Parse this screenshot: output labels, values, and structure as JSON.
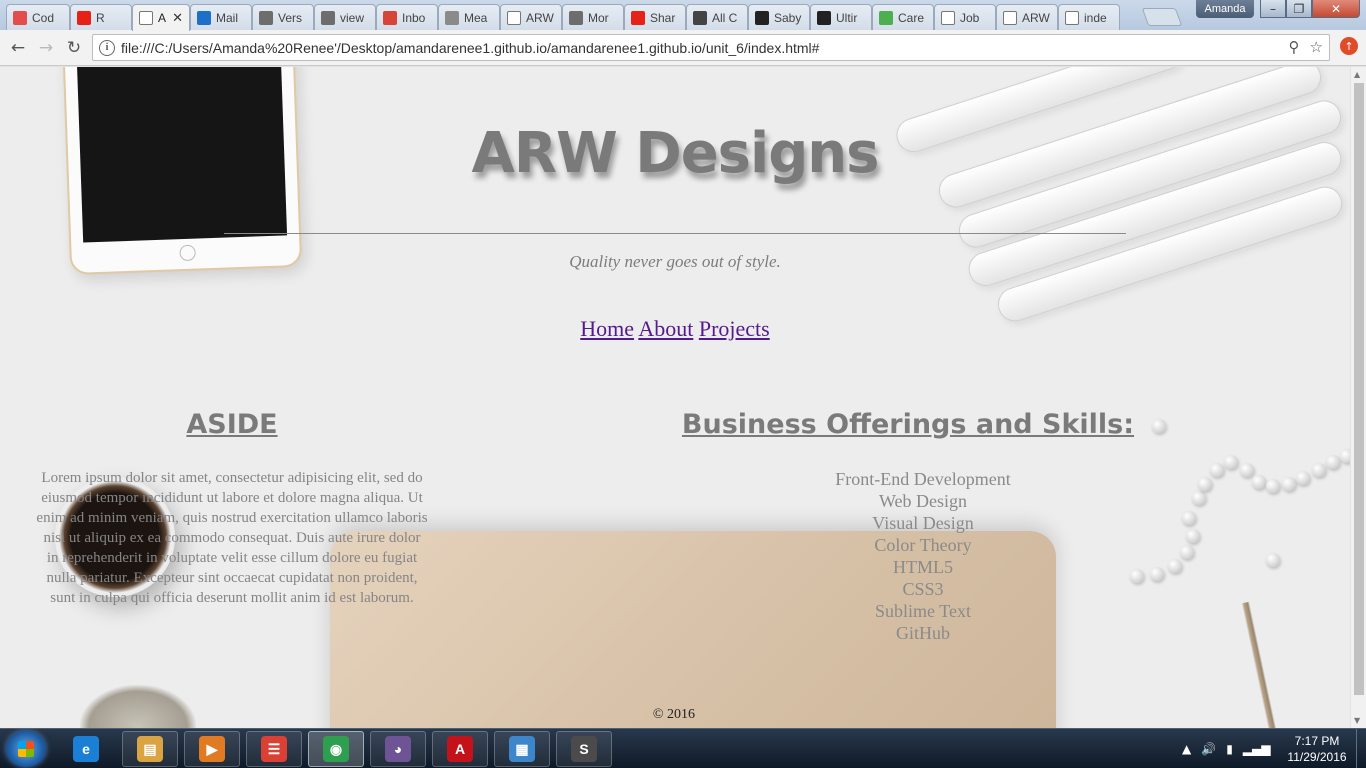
{
  "browser": {
    "tabs": [
      {
        "title": "Cod",
        "icon": "codecademy-icon",
        "color": "#e44d4d"
      },
      {
        "title": "R",
        "icon": "youtube-icon",
        "color": "#e62117"
      },
      {
        "title": "A",
        "icon": "page-icon",
        "color": "#ffffff",
        "active": true
      },
      {
        "title": "Mail",
        "icon": "outlook-icon",
        "color": "#1e6fc7"
      },
      {
        "title": "Vers",
        "icon": "b-icon",
        "color": "#6d6d6d"
      },
      {
        "title": "view",
        "icon": "b-icon",
        "color": "#6d6d6d"
      },
      {
        "title": "Inbo",
        "icon": "gmail-icon",
        "color": "#d64537"
      },
      {
        "title": "Mea",
        "icon": "eat-icon",
        "color": "#8a8a8a"
      },
      {
        "title": "ARW",
        "icon": "page-icon",
        "color": "#ffffff"
      },
      {
        "title": "Mor",
        "icon": "b-icon",
        "color": "#6d6d6d"
      },
      {
        "title": "Shar",
        "icon": "youtube-icon",
        "color": "#e62117"
      },
      {
        "title": "All C",
        "icon": "we-icon",
        "color": "#444444"
      },
      {
        "title": "Saby",
        "icon": "pb-icon",
        "color": "#222222"
      },
      {
        "title": "Ultir",
        "icon": "pb-icon",
        "color": "#222222"
      },
      {
        "title": "Care",
        "icon": "leaf-icon",
        "color": "#4caf50"
      },
      {
        "title": "Job",
        "icon": "page-icon",
        "color": "#ffffff"
      },
      {
        "title": "ARW",
        "icon": "page-icon",
        "color": "#ffffff"
      },
      {
        "title": "inde",
        "icon": "page-icon",
        "color": "#ffffff"
      }
    ],
    "user": "Amanda",
    "url": "file:///C:/Users/Amanda%20Renee'/Desktop/amandarenee1.github.io/amandarenee1.github.io/unit_6/index.html#",
    "info_glyph": "i",
    "back_glyph": "←",
    "forward_glyph": "→",
    "reload_glyph": "↻",
    "zoom_glyph": "⚲",
    "star_glyph": "☆",
    "close_glyph": "✕",
    "min_glyph": "–",
    "max_glyph": "❐"
  },
  "page": {
    "title": "ARW Designs",
    "tagline": "Quality never goes out of style.",
    "nav": [
      "Home",
      "About",
      "Projects"
    ],
    "aside_heading": "ASIDE",
    "aside_text": "Lorem ipsum dolor sit amet, consectetur adipisicing elit, sed do eiusmod tempor incididunt ut labore et dolore magna aliqua. Ut enim ad minim veniam, quis nostrud exercitation ullamco laboris nisi ut aliquip ex ea commodo consequat. Duis aute irure dolor in reprehenderit in voluptate velit esse cillum dolore eu fugiat nulla pariatur. Excepteur sint occaecat cupidatat non proident, sunt in culpa qui officia deserunt mollit anim id est laborum.",
    "skills_heading": "Business Offerings and Skills:",
    "skills": [
      "Front-End Development",
      "Web Design",
      "Visual Design",
      "Color Theory",
      "HTML5",
      "CSS3",
      "Sublime Text",
      "GitHub"
    ],
    "footer": "© 2016"
  },
  "taskbar": {
    "items": [
      {
        "name": "internet-explorer-icon",
        "glyph": "e",
        "color": "#1b7fd6"
      },
      {
        "name": "file-explorer-icon",
        "glyph": "▤",
        "color": "#d9a441"
      },
      {
        "name": "media-player-icon",
        "glyph": "▶",
        "color": "#e07b24"
      },
      {
        "name": "todoist-icon",
        "glyph": "☰",
        "color": "#db4035"
      },
      {
        "name": "chrome-icon",
        "glyph": "◉",
        "color": "#2e9e4f",
        "active": true
      },
      {
        "name": "github-desktop-icon",
        "glyph": "◕",
        "color": "#6e5494"
      },
      {
        "name": "acrobat-icon",
        "glyph": "A",
        "color": "#c4121b"
      },
      {
        "name": "photo-viewer-icon",
        "glyph": "▦",
        "color": "#3c86c9"
      },
      {
        "name": "sublime-text-icon",
        "glyph": "S",
        "color": "#4b4b4b"
      }
    ],
    "time": "7:17 PM",
    "date": "11/29/2016",
    "tray_glyphs": [
      "▲",
      "🔊",
      "▮",
      "▂▄▆"
    ]
  }
}
